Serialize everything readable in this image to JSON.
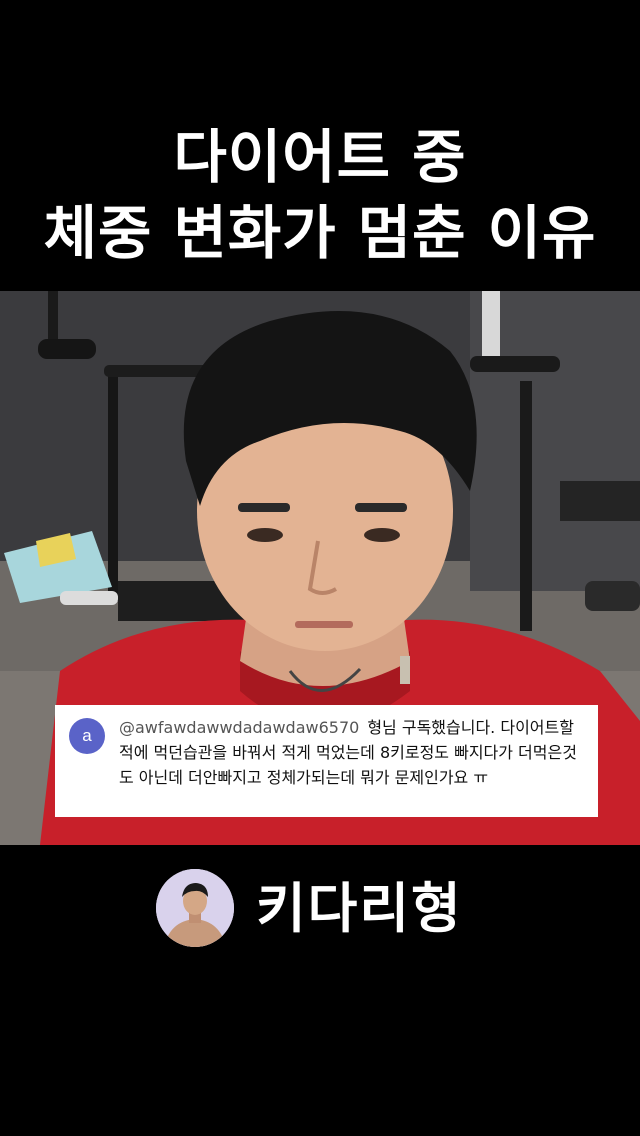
{
  "title": {
    "line1": "다이어트 중",
    "line2": "체중 변화가 멈춘 이유"
  },
  "comment": {
    "avatar_letter": "a",
    "username": "@awfawdawwdadawdaw6570",
    "text": "형님 구독했습니다. 다이어트할적에 먹던습관을 바꿔서 적게 먹었는데 8키로정도 빠지다가 더먹은것도 아닌데 더안빠지고 정체가되는데 뭐가 문제인가요 ㅠ"
  },
  "channel": {
    "name": "키다리형"
  },
  "colors": {
    "background": "#000000",
    "comment_avatar": "#5a63c8",
    "shirt": "#c8202a",
    "channel_avatar_bg": "#d9d2ec"
  }
}
